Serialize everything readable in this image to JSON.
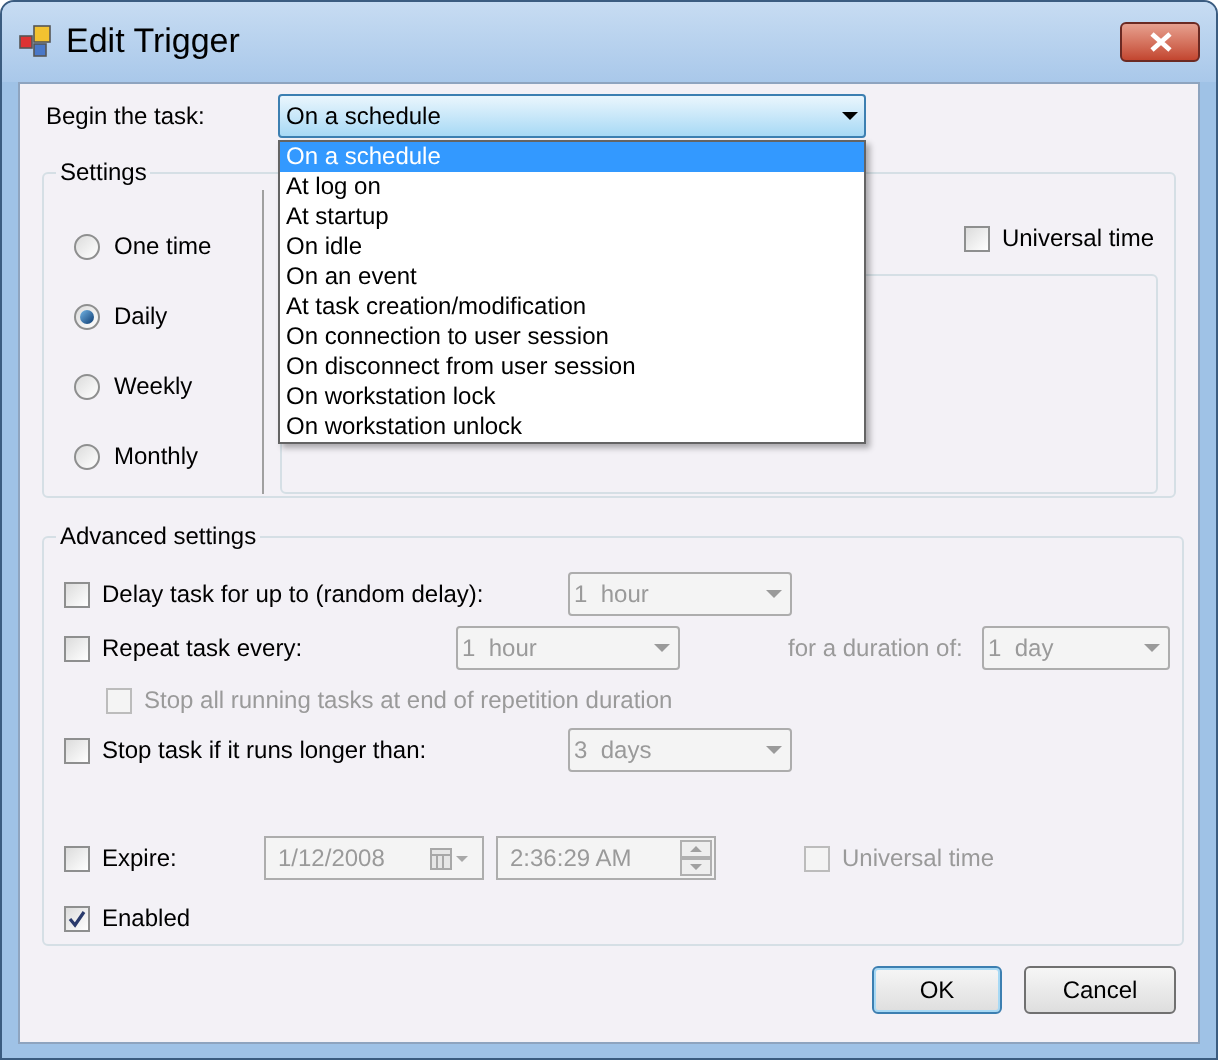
{
  "window": {
    "title": "Edit Trigger"
  },
  "begin_task": {
    "label": "Begin the task:",
    "value": "On a schedule",
    "expanded": true,
    "options": [
      {
        "label": "On a schedule",
        "selected": true
      },
      {
        "label": "At log on",
        "selected": false
      },
      {
        "label": "At startup",
        "selected": false
      },
      {
        "label": "On idle",
        "selected": false
      },
      {
        "label": "On an event",
        "selected": false
      },
      {
        "label": "At task creation/modification",
        "selected": false
      },
      {
        "label": "On connection to user session",
        "selected": false
      },
      {
        "label": "On disconnect from user session",
        "selected": false
      },
      {
        "label": "On workstation lock",
        "selected": false
      },
      {
        "label": "On workstation unlock",
        "selected": false
      }
    ]
  },
  "settings": {
    "title": "Settings",
    "schedules": [
      {
        "label": "One time",
        "selected": false
      },
      {
        "label": "Daily",
        "selected": true
      },
      {
        "label": "Weekly",
        "selected": false
      },
      {
        "label": "Monthly",
        "selected": false
      }
    ],
    "universal_time": {
      "label": "Universal time",
      "checked": false,
      "disabled": false
    }
  },
  "advanced": {
    "title": "Advanced settings",
    "delay": {
      "label": "Delay task for up to (random delay):",
      "checked": false,
      "combo": {
        "value": "1  hour",
        "disabled": true
      }
    },
    "repeat": {
      "label": "Repeat task every:",
      "checked": false,
      "combo": {
        "value": "1  hour",
        "disabled": true
      },
      "duration_label": "for a duration of:",
      "duration_combo": {
        "value": "1  day",
        "disabled": true
      }
    },
    "stop_all": {
      "label": "Stop all running tasks at end of repetition duration",
      "checked": false,
      "disabled": true
    },
    "stop_longer": {
      "label": "Stop task if it runs longer than:",
      "checked": false,
      "combo": {
        "value": "3  days",
        "disabled": true
      }
    },
    "expire": {
      "label": "Expire:",
      "checked": false,
      "date": "1/12/2008",
      "time": "2:36:29 AM",
      "disabled": true
    },
    "expire_universal": {
      "label": "Universal time",
      "checked": false,
      "disabled": true
    },
    "enabled": {
      "label": "Enabled",
      "checked": true
    }
  },
  "buttons": [
    {
      "label": "OK",
      "default": true
    },
    {
      "label": "Cancel",
      "default": false
    }
  ]
}
